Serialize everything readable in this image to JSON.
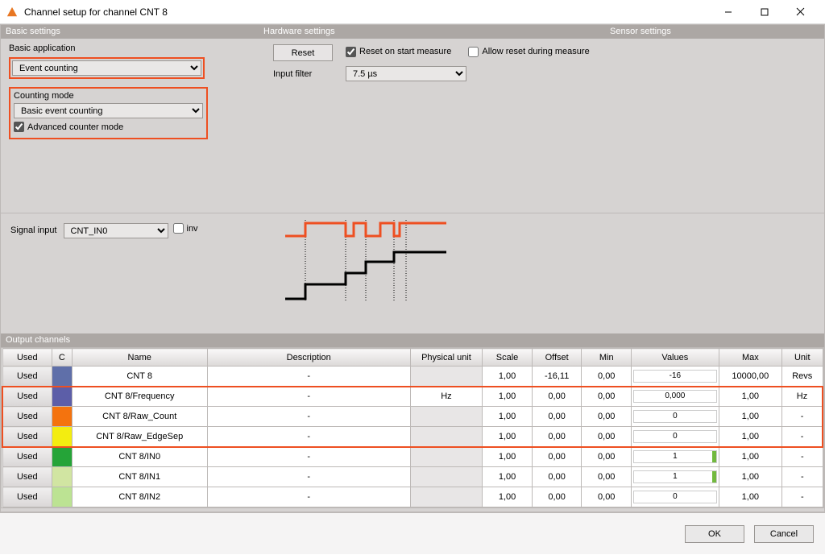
{
  "window": {
    "title": "Channel setup for channel CNT 8"
  },
  "sections": {
    "basic": "Basic settings",
    "hardware": "Hardware settings",
    "sensor": "Sensor settings",
    "output": "Output channels"
  },
  "basic": {
    "app_label": "Basic application",
    "app_value": "Event counting",
    "mode_label": "Counting mode",
    "mode_value": "Basic event counting",
    "adv_label": "Advanced counter mode",
    "adv_checked": true
  },
  "hardware": {
    "reset_btn": "Reset",
    "reset_on_start_label": "Reset on start measure",
    "reset_on_start_checked": true,
    "allow_reset_label": "Allow reset during measure",
    "allow_reset_checked": false,
    "input_filter_label": "Input filter",
    "input_filter_value": "7.5 µs"
  },
  "signal": {
    "label": "Signal input",
    "value": "CNT_IN0",
    "inv_label": "inv",
    "inv_checked": false
  },
  "table": {
    "headers": [
      "Used",
      "C",
      "Name",
      "Description",
      "Physical unit",
      "Scale",
      "Offset",
      "Min",
      "Values",
      "Max",
      "Unit"
    ],
    "rows": [
      {
        "used": "Used",
        "color": "#5f6fa9",
        "name": "CNT 8",
        "desc": "-",
        "phys": "",
        "scale": "1,00",
        "offset": "-16,11",
        "min": "0,00",
        "value": "-16",
        "max": "10000,00",
        "unit": "Revs",
        "phys_grey": true,
        "has_bar": false,
        "highlight": false
      },
      {
        "used": "Used",
        "color": "#5c5ea8",
        "name": "CNT 8/Frequency",
        "desc": "-",
        "phys": "Hz",
        "scale": "1,00",
        "offset": "0,00",
        "min": "0,00",
        "value": "0,000",
        "max": "1,00",
        "unit": "Hz",
        "phys_grey": false,
        "has_bar": false,
        "highlight": "top"
      },
      {
        "used": "Used",
        "color": "#f4730e",
        "name": "CNT 8/Raw_Count",
        "desc": "-",
        "phys": "",
        "scale": "1,00",
        "offset": "0,00",
        "min": "0,00",
        "value": "0",
        "max": "1,00",
        "unit": "-",
        "phys_grey": true,
        "has_bar": false,
        "highlight": "mid"
      },
      {
        "used": "Used",
        "color": "#f3ed10",
        "name": "CNT 8/Raw_EdgeSep",
        "desc": "-",
        "phys": "",
        "scale": "1,00",
        "offset": "0,00",
        "min": "0,00",
        "value": "0",
        "max": "1,00",
        "unit": "-",
        "phys_grey": true,
        "has_bar": false,
        "highlight": "bot"
      },
      {
        "used": "Used",
        "color": "#25a438",
        "name": "CNT 8/IN0",
        "desc": "-",
        "phys": "",
        "scale": "1,00",
        "offset": "0,00",
        "min": "0,00",
        "value": "1",
        "max": "1,00",
        "unit": "-",
        "phys_grey": true,
        "has_bar": true,
        "highlight": false
      },
      {
        "used": "Used",
        "color": "#d1e5a2",
        "name": "CNT 8/IN1",
        "desc": "-",
        "phys": "",
        "scale": "1,00",
        "offset": "0,00",
        "min": "0,00",
        "value": "1",
        "max": "1,00",
        "unit": "-",
        "phys_grey": true,
        "has_bar": true,
        "highlight": false
      },
      {
        "used": "Used",
        "color": "#bce393",
        "name": "CNT 8/IN2",
        "desc": "-",
        "phys": "",
        "scale": "1,00",
        "offset": "0,00",
        "min": "0,00",
        "value": "0",
        "max": "1,00",
        "unit": "-",
        "phys_grey": true,
        "has_bar": false,
        "highlight": false
      }
    ]
  },
  "footer": {
    "ok": "OK",
    "cancel": "Cancel"
  }
}
